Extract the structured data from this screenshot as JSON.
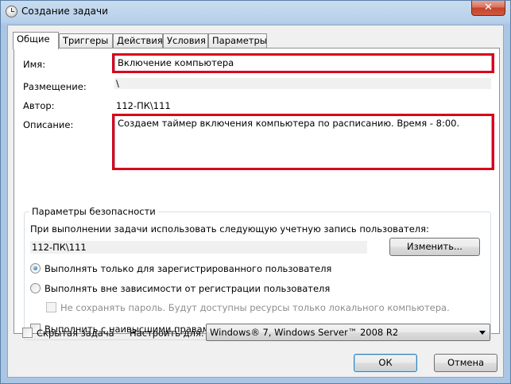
{
  "window": {
    "title": "Создание задачи",
    "close_label": "✕"
  },
  "tabs": [
    {
      "label": "Общие",
      "active": true
    },
    {
      "label": "Триггеры",
      "active": false
    },
    {
      "label": "Действия",
      "active": false
    },
    {
      "label": "Условия",
      "active": false
    },
    {
      "label": "Параметры",
      "active": false
    }
  ],
  "general": {
    "name_label": "Имя:",
    "name_value": "Включение компьютера",
    "location_label": "Размещение:",
    "location_value": "\\",
    "author_label": "Автор:",
    "author_value": "112-ПК\\111",
    "description_label": "Описание:",
    "description_value": "Создаем таймер включения компьютера по расписанию. Время - 8:00."
  },
  "security": {
    "group_title": "Параметры безопасности",
    "run_as_text": "При выполнении задачи использовать следующую учетную запись пользователя:",
    "account_value": "112-ПК\\111",
    "change_button": "Изменить...",
    "radio_logged_on": "Выполнять только для зарегистрированного пользователя",
    "radio_logged_on_selected": true,
    "radio_any": "Выполнять вне зависимости от регистрации пользователя",
    "dont_store_password": "Не сохранять пароль. Будут доступны ресурсы только локального компьютера.",
    "highest_privileges": "Выполнить с наивысшими правами"
  },
  "footer": {
    "hidden_task": "Скрытая задача",
    "configure_for_label": "Настроить для:",
    "configure_for_value": "Windows® 7, Windows Server™ 2008 R2",
    "ok_button": "ОК",
    "cancel_button": "Отмена"
  },
  "colors": {
    "highlight_frame": "#d9001b",
    "titlebar": "#b8d0ea"
  }
}
